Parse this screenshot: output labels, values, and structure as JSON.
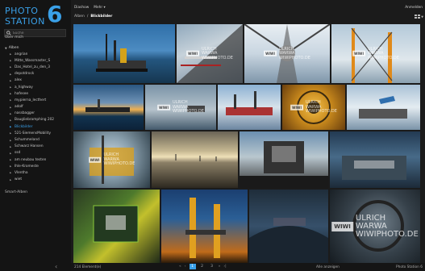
{
  "logo": {
    "line1": "PHOTO",
    "line2": "STATION",
    "digit": "6"
  },
  "search": {
    "placeholder": "Suche"
  },
  "sidebar": {
    "about": "Über mich",
    "root": "Alben",
    "items": [
      {
        "label": "angrian"
      },
      {
        "label": "Mitte_Wassmaster_S"
      },
      {
        "label": "Das_Hotel_zu_den_3"
      },
      {
        "label": "depotdrock"
      },
      {
        "label": "alex"
      },
      {
        "label": "a_highway"
      },
      {
        "label": "hafesee"
      },
      {
        "label": "mypierna_lecthert"
      },
      {
        "label": "adolf"
      },
      {
        "label": "nassbagger"
      },
      {
        "label": "Baugliebramphing 202"
      },
      {
        "label": "Blickbilder",
        "active": true
      },
      {
        "label": "521-SiemensMobility"
      },
      {
        "label": "Schummeland"
      },
      {
        "label": "Schwarz Hansen"
      },
      {
        "label": "ssd"
      },
      {
        "label": "am neubau testen"
      },
      {
        "label": "Ihle-Kromeste"
      },
      {
        "label": "Vlentha"
      },
      {
        "label": "wiet"
      }
    ],
    "smart": "Smart-Alben",
    "collapse_glyph": "‹"
  },
  "topbar": {
    "menu": [
      "Diashow",
      "Mehr ▾"
    ],
    "login": "Anmelden",
    "breadcrumb": {
      "parent": "Alben",
      "sep": "/",
      "current": "Blickbilder"
    }
  },
  "watermark": {
    "logo": "WIWI",
    "line1": "ULRICH WARWA",
    "line2": "WIWIPHOTO.DE"
  },
  "footer": {
    "count": "214 Element(e)",
    "pages": {
      "first": "«",
      "prev": "‹",
      "current": "1",
      "p2": "2",
      "p3": "3",
      "next": "»",
      "last": "›|"
    },
    "show_all": "Alle anzeigen",
    "brand": "Photo Station 6"
  },
  "colors": {
    "accent": "#3aa0e8",
    "background": "#1b1b1b",
    "sidebar": "#141414"
  }
}
